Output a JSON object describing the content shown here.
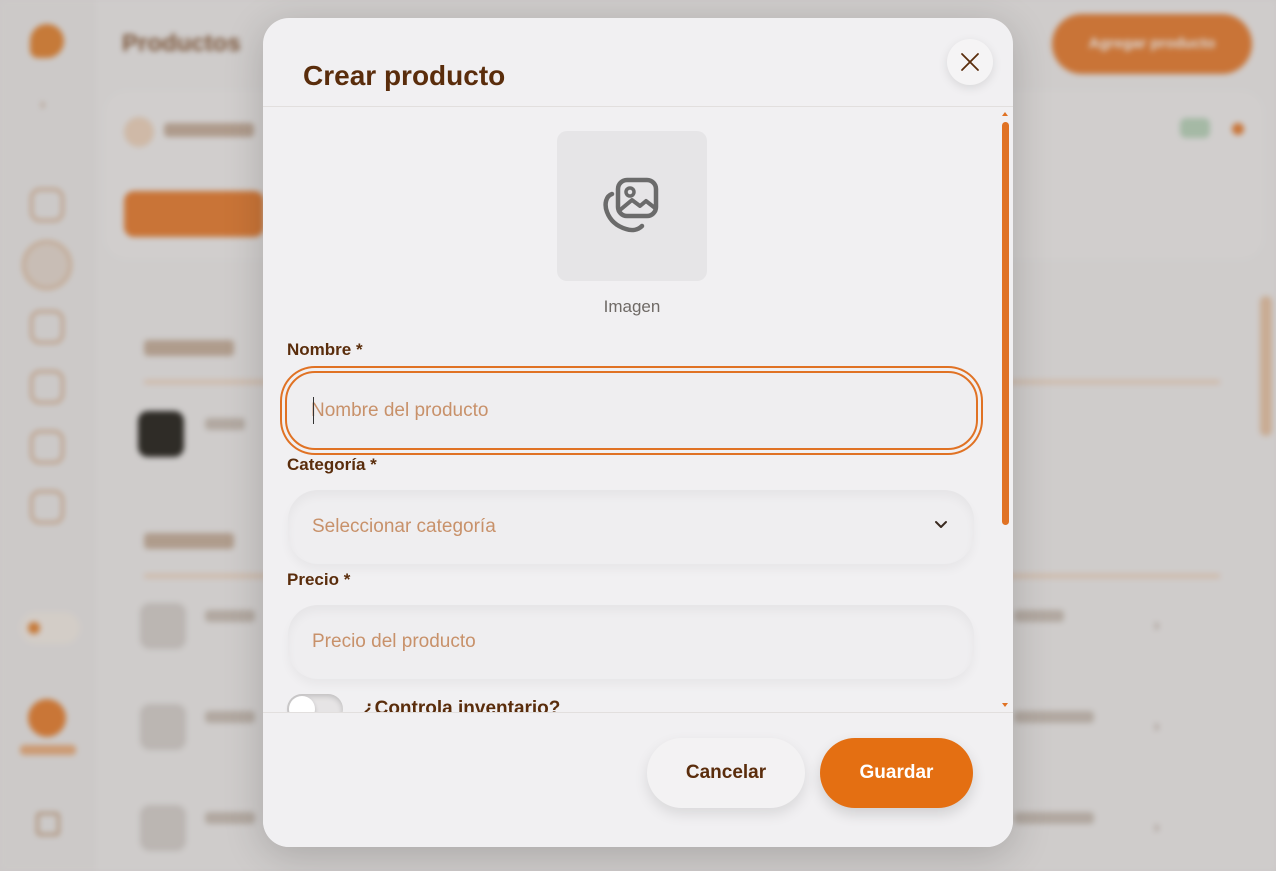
{
  "background": {
    "page_title": "Productos",
    "add_button": "Agregar producto"
  },
  "modal": {
    "title": "Crear producto",
    "close_icon": "close-icon",
    "image": {
      "icon": "image-gallery-icon",
      "label": "Imagen"
    },
    "fields": {
      "name": {
        "label": "Nombre *",
        "placeholder": "Nombre del producto"
      },
      "category": {
        "label": "Categoría *",
        "placeholder": "Seleccionar categoría",
        "icon": "chevron-down-icon"
      },
      "price": {
        "label": "Precio *",
        "placeholder": "Precio del producto"
      },
      "inventory": {
        "label": "¿Controla inventario?",
        "enabled": false
      }
    },
    "footer": {
      "cancel_label": "Cancelar",
      "save_label": "Guardar"
    }
  },
  "colors": {
    "accent": "#e46f12",
    "title_brown": "#5a2d0c",
    "placeholder": "#c8916a"
  }
}
